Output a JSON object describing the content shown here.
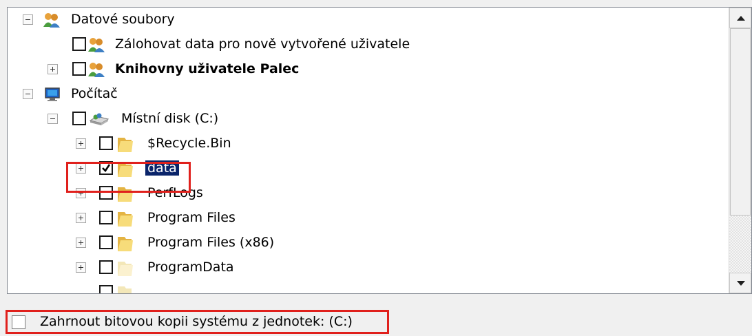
{
  "tree": {
    "items": [
      {
        "label": "Datové soubory",
        "icon": "users-icon",
        "expander": "minus",
        "checkbox": false
      },
      {
        "label": "Zálohovat data pro nově vytvořené uživatele",
        "icon": "users-icon",
        "expander": "none",
        "checkbox": true,
        "checked": false
      },
      {
        "label": "Knihovny uživatele Palec",
        "icon": "users-icon",
        "expander": "plus",
        "checkbox": true,
        "checked": false,
        "bold": true
      },
      {
        "label": "Počítač",
        "icon": "computer-icon",
        "expander": "minus",
        "checkbox": false
      },
      {
        "label": "Místní disk (C:)",
        "icon": "hard-drive-icon",
        "expander": "minus",
        "checkbox": true,
        "checked": false
      },
      {
        "label": "$Recycle.Bin",
        "icon": "folder-icon",
        "expander": "plus",
        "checkbox": true,
        "checked": false
      },
      {
        "label": "data",
        "icon": "folder-icon",
        "expander": "plus",
        "checkbox": true,
        "checked": true,
        "selected": true
      },
      {
        "label": "PerfLogs",
        "icon": "folder-icon",
        "expander": "plus",
        "checkbox": true,
        "checked": false
      },
      {
        "label": "Program Files",
        "icon": "folder-icon",
        "expander": "plus",
        "checkbox": true,
        "checked": false
      },
      {
        "label": "Program Files (x86)",
        "icon": "folder-icon",
        "expander": "plus",
        "checkbox": true,
        "checked": false
      },
      {
        "label": "ProgramData",
        "icon": "folder-icon",
        "expander": "plus",
        "checkbox": true,
        "checked": false
      }
    ]
  },
  "bottom_option": {
    "label": "Zahrnout bitovou kopii systému z jednotek: (C:)",
    "checked": false
  },
  "colors": {
    "highlight": "#e0201c",
    "selection": "#0a246a",
    "folder": "#f2cb61"
  }
}
